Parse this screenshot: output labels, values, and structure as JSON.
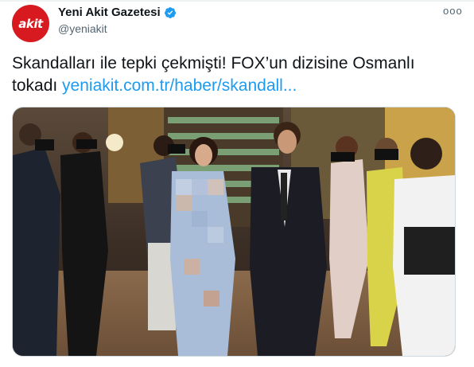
{
  "account": {
    "avatar_text": "akit",
    "display_name": "Yeni Akit Gazetesi",
    "handle": "@yeniakit",
    "verified": true,
    "avatar_color": "#d71920",
    "verified_color": "#1d9bf0"
  },
  "menu": {
    "more_label": "ooo"
  },
  "tweet": {
    "text": "Skandalları ile tepki çekmişti! FOX’un dizisine Osmanlı tokadı ",
    "link": "yeniakit.com.tr/haber/skandall..."
  },
  "media": {
    "type": "photo",
    "description_icon": "photo",
    "blurred_region": true
  }
}
